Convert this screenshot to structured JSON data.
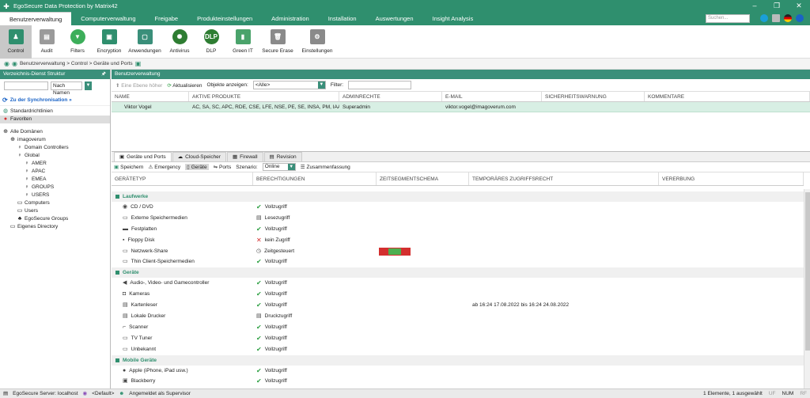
{
  "app": {
    "title": "EgoSecure Data Protection by Matrix42",
    "search_placeholder": "Suchen..."
  },
  "menu": [
    "Benutzerverwaltung",
    "Computerverwaltung",
    "Freigabe",
    "Produkteinstellungen",
    "Administration",
    "Installation",
    "Auswertungen",
    "Insight Analysis"
  ],
  "ribbon": [
    {
      "label": "Control",
      "icon": "control-icon",
      "color": "#2f8f6e"
    },
    {
      "label": "Audit",
      "icon": "audit-icon",
      "color": "#9a9a9a"
    },
    {
      "label": "Filters",
      "icon": "filter-icon",
      "color": "#3cae5a"
    },
    {
      "label": "Encryption",
      "icon": "encryption-icon",
      "color": "#2f8f6e"
    },
    {
      "label": "Anwendungen",
      "icon": "applications-icon",
      "color": "#3a8f7a"
    },
    {
      "label": "Antivirus",
      "icon": "antivirus-icon",
      "color": "#2e7d32"
    },
    {
      "label": "DLP",
      "icon": "dlp-icon",
      "color": "#2e7d32"
    },
    {
      "label": "Green IT",
      "icon": "green-it-icon",
      "color": "#4aa36b"
    },
    {
      "label": "Secure Erase",
      "icon": "secure-erase-icon",
      "color": "#8a8a8a"
    },
    {
      "label": "Einstellungen",
      "icon": "settings-gear-icon",
      "color": "#8a8a8a"
    }
  ],
  "breadcrumb": "Benutzerverwaltung > Control > Geräte und Ports",
  "left": {
    "header": "Verzeichnis-Dienst Struktur",
    "sort": "Nach Namen",
    "sync": "Zu der Synchronisation »",
    "tree": [
      {
        "label": "Standardrichtlinien",
        "icon": "policy-icon",
        "level": 0,
        "sel": false
      },
      {
        "label": "Favoriten",
        "icon": "favorites-icon",
        "level": 0,
        "sel": true
      },
      {
        "label": "Alle Domänen",
        "icon": "domains-icon",
        "level": 0,
        "sel": false
      },
      {
        "label": "imagoverum",
        "icon": "domain-icon",
        "level": 1,
        "sel": false
      },
      {
        "label": "Domain Controllers",
        "icon": "ou-icon",
        "level": 2,
        "sel": false
      },
      {
        "label": "Global",
        "icon": "ou-icon",
        "level": 2,
        "sel": false
      },
      {
        "label": "AMER",
        "icon": "ou-icon",
        "level": 3,
        "sel": false
      },
      {
        "label": "APAC",
        "icon": "ou-icon",
        "level": 3,
        "sel": false
      },
      {
        "label": "EMEA",
        "icon": "ou-icon",
        "level": 3,
        "sel": false
      },
      {
        "label": "GROUPS",
        "icon": "ou-icon",
        "level": 3,
        "sel": false
      },
      {
        "label": "USERS",
        "icon": "ou-icon",
        "level": 3,
        "sel": false
      },
      {
        "label": "Computers",
        "icon": "folder-icon",
        "level": 2,
        "sel": false
      },
      {
        "label": "Users",
        "icon": "folder-icon",
        "level": 2,
        "sel": false
      },
      {
        "label": "EgoSecure Groups",
        "icon": "groups-icon",
        "level": 2,
        "sel": false
      },
      {
        "label": "Eigenes Directory",
        "icon": "folder-icon",
        "level": 1,
        "sel": false
      }
    ]
  },
  "top": {
    "header": "Benutzerverwaltung",
    "up_label": "Eine Ebene höher",
    "refresh_label": "Aktualisieren",
    "show_label": "Objekte anzeigen:",
    "show_value": "<Alle>",
    "filter_label": "Filter:",
    "columns": [
      "Name",
      "Aktive Produkte",
      "Adminrechte",
      "E-Mail",
      "Sicherheitswarnung",
      "Kommentare"
    ],
    "row": [
      "Viktor Vogel",
      "AC, SA, SC, APC, RDE, CSE, LFE, NSE, PE, SE, INSA, PM, IAA",
      "Superadmin",
      "viktor.vogel@imagoverum.com",
      "",
      ""
    ]
  },
  "bottom": {
    "tabs": [
      "Geräte und Ports",
      "Cloud-Speicher",
      "Firewall",
      "Revision"
    ],
    "save_label": "Speichern",
    "emergency_label": "Emergency",
    "devices_label": "Geräte",
    "ports_label": "Ports",
    "scenario_label": "Szenario:",
    "scenario_value": "Online",
    "summary_label": "Zusammenfassung",
    "columns": [
      "Gerätetyp",
      "Berechtigungen",
      "Zeitsegmentschema",
      "Temporäres Zugriffsrecht",
      "Vererbung"
    ],
    "groups": [
      {
        "name": "Laufwerke",
        "rows": [
          {
            "type": "CD / DVD",
            "icon": "disc-icon",
            "perm": "Vollzugriff",
            "status": "ok",
            "sched": false,
            "temp": ""
          },
          {
            "type": "Externe Speichermedien",
            "icon": "external-storage-icon",
            "perm": "Lesezugriff",
            "status": "read",
            "sched": false,
            "temp": ""
          },
          {
            "type": "Festplatten",
            "icon": "harddisk-icon",
            "perm": "Vollzugriff",
            "status": "ok",
            "sched": false,
            "temp": ""
          },
          {
            "type": "Floppy Disk",
            "icon": "floppy-icon",
            "perm": "kein Zugriff",
            "status": "no",
            "sched": false,
            "temp": ""
          },
          {
            "type": "Netzwerk-Share",
            "icon": "network-share-icon",
            "perm": "Zeitgesteuert",
            "status": "time",
            "sched": true,
            "temp": ""
          },
          {
            "type": "Thin Client-Speichermedien",
            "icon": "thin-client-icon",
            "perm": "Vollzugriff",
            "status": "ok",
            "sched": false,
            "temp": ""
          }
        ]
      },
      {
        "name": "Geräte",
        "rows": [
          {
            "type": "Audio-, Video- und Gamecontroller",
            "icon": "audio-icon",
            "perm": "Vollzugriff",
            "status": "ok",
            "sched": false,
            "temp": ""
          },
          {
            "type": "Kameras",
            "icon": "camera-icon",
            "perm": "Vollzugriff",
            "status": "ok",
            "sched": false,
            "temp": ""
          },
          {
            "type": "Kartenleser",
            "icon": "card-reader-icon",
            "perm": "Vollzugriff",
            "status": "ok",
            "sched": false,
            "temp": "ab 16:24 17.08.2022 bis 16:24 24.08.2022"
          },
          {
            "type": "Lokale Drucker",
            "icon": "printer-icon",
            "perm": "Druckzugriff",
            "status": "print",
            "sched": false,
            "temp": ""
          },
          {
            "type": "Scanner",
            "icon": "scanner-icon",
            "perm": "Vollzugriff",
            "status": "ok",
            "sched": false,
            "temp": ""
          },
          {
            "type": "TV Tuner",
            "icon": "tv-icon",
            "perm": "Vollzugriff",
            "status": "ok",
            "sched": false,
            "temp": ""
          },
          {
            "type": "Unbekannt",
            "icon": "unknown-icon",
            "perm": "Vollzugriff",
            "status": "ok",
            "sched": false,
            "temp": ""
          }
        ]
      },
      {
        "name": "Mobile Geräte",
        "rows": [
          {
            "type": "Apple (iPhone, iPad usw.)",
            "icon": "apple-icon",
            "perm": "Vollzugriff",
            "status": "ok",
            "sched": false,
            "temp": ""
          },
          {
            "type": "Blackberry",
            "icon": "blackberry-icon",
            "perm": "Vollzugriff",
            "status": "ok",
            "sched": false,
            "temp": ""
          }
        ]
      }
    ]
  },
  "status": {
    "server": "EgoSecure Server: localhost",
    "tenant": "<Default>",
    "login": "Angemeldet als Supervisor",
    "selection": "1 Elemente, 1 ausgewählt",
    "uf": "UF",
    "num": "NUM",
    "rf": "RF"
  }
}
